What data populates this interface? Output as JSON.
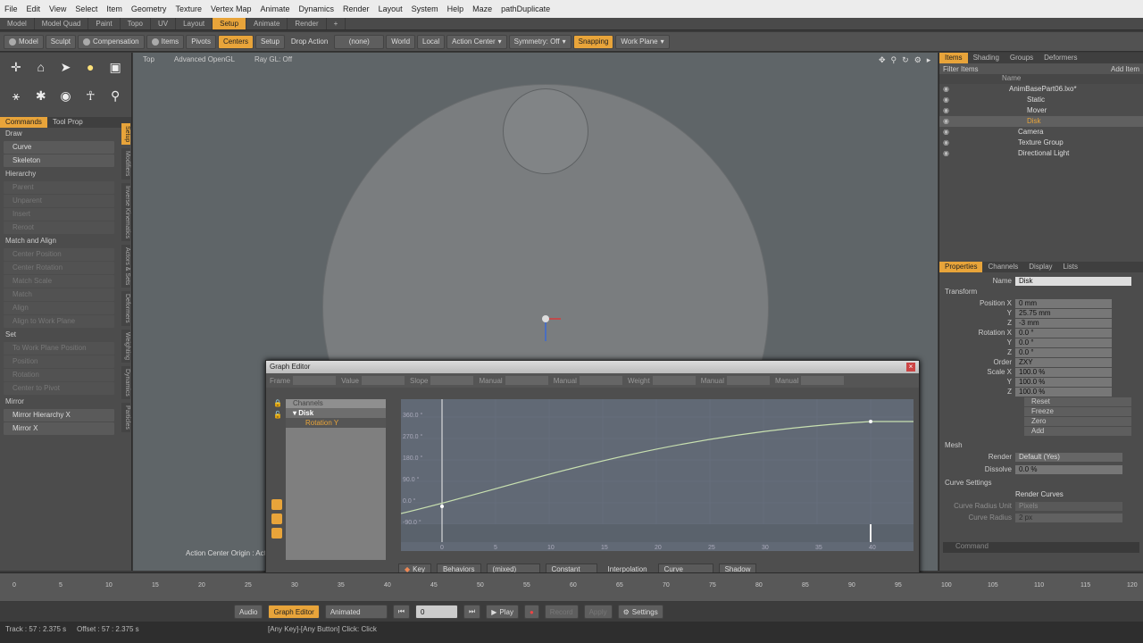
{
  "menu": [
    "File",
    "Edit",
    "View",
    "Select",
    "Item",
    "Geometry",
    "Texture",
    "Vertex Map",
    "Animate",
    "Dynamics",
    "Render",
    "Layout",
    "System",
    "Help",
    "Maze",
    "pathDuplicate"
  ],
  "layout_tabs": [
    "Model",
    "Model Quad",
    "Paint",
    "Topo",
    "UV",
    "Layout",
    "Setup",
    "Animate",
    "Render",
    "+"
  ],
  "active_layout_tab": "Setup",
  "toolbar": {
    "model": "Model",
    "sculpt": "Sculpt",
    "compensation": "Compensation",
    "items": "Items",
    "pivots": "Pivots",
    "centers": "Centers",
    "setup": "Setup",
    "drop_action": "Drop Action",
    "drop_value": "(none)",
    "world": "World",
    "local": "Local",
    "action_center": "Action Center",
    "symmetry": "Symmetry: Off",
    "snapping": "Snapping",
    "work_plane": "Work Plane"
  },
  "viewport_header": {
    "view": "Top",
    "render": "Advanced OpenGL",
    "raygl": "Ray GL: Off"
  },
  "action_center_label": "Action Center Origin : Acti",
  "left_tabs": [
    "Commands",
    "Tool Prop"
  ],
  "vertical_tabs": [
    "Setup",
    "Modifiers",
    "Inverse Kinematics",
    "Actors & Sets",
    "Deformers",
    "Weighting",
    "Dynamics",
    "Particles"
  ],
  "commands": [
    {
      "type": "sec",
      "label": "Draw"
    },
    {
      "type": "cmd",
      "label": "Curve"
    },
    {
      "type": "cmd",
      "label": "Skeleton"
    },
    {
      "type": "sec",
      "label": "Hierarchy"
    },
    {
      "type": "dim",
      "label": "Parent"
    },
    {
      "type": "dim",
      "label": "Unparent"
    },
    {
      "type": "dim",
      "label": "Insert"
    },
    {
      "type": "dim",
      "label": "Reroot"
    },
    {
      "type": "sec",
      "label": "Match and Align"
    },
    {
      "type": "dim",
      "label": "Center Position"
    },
    {
      "type": "dim",
      "label": "Center Rotation"
    },
    {
      "type": "dim",
      "label": "Match Scale"
    },
    {
      "type": "dim",
      "label": "Match"
    },
    {
      "type": "dim",
      "label": "Align"
    },
    {
      "type": "dim",
      "label": "Align to Work Plane"
    },
    {
      "type": "sec",
      "label": "Set"
    },
    {
      "type": "dim",
      "label": "To Work Plane Position"
    },
    {
      "type": "dim",
      "label": "Position"
    },
    {
      "type": "dim",
      "label": "Rotation"
    },
    {
      "type": "dim",
      "label": "Center to Pivot"
    },
    {
      "type": "sec",
      "label": "Mirror"
    },
    {
      "type": "cmd",
      "label": "Mirror Hierarchy X"
    },
    {
      "type": "cmd",
      "label": "Mirror X"
    }
  ],
  "items_tabs": [
    "Items",
    "Shading",
    "Groups",
    "Deformers"
  ],
  "filter_items": "Filter Items",
  "add_item": "Add Item",
  "name_header": "Name",
  "scene_items": [
    {
      "label": "AnimBasePart06.lxo*",
      "indent": 0,
      "sel": false
    },
    {
      "label": "Static",
      "indent": 2,
      "sel": false
    },
    {
      "label": "Mover",
      "indent": 2,
      "sel": false
    },
    {
      "label": "Disk",
      "indent": 2,
      "sel": true
    },
    {
      "label": "Camera",
      "indent": 1,
      "sel": false
    },
    {
      "label": "Texture Group",
      "indent": 1,
      "sel": false
    },
    {
      "label": "Directional Light",
      "indent": 1,
      "sel": false
    }
  ],
  "prop_tabs": [
    "Properties",
    "Channels",
    "Display",
    "Lists"
  ],
  "properties": {
    "name_label": "Name",
    "name": "Disk",
    "transform": "Transform",
    "rows": [
      {
        "label": "Position X",
        "value": "0 mm"
      },
      {
        "label": "Y",
        "value": "25.75 mm"
      },
      {
        "label": "Z",
        "value": "-3 mm"
      },
      {
        "label": "Rotation X",
        "value": "0.0 °"
      },
      {
        "label": "Y",
        "value": "0.0 °"
      },
      {
        "label": "Z",
        "value": "0.0 °"
      },
      {
        "label": "Order",
        "value": "ZXY"
      },
      {
        "label": "Scale X",
        "value": "100.0 %"
      },
      {
        "label": "Y",
        "value": "100.0 %"
      },
      {
        "label": "Z",
        "value": "100.0 %"
      }
    ],
    "reset_buttons": [
      "Reset",
      "Freeze",
      "Zero",
      "Add"
    ],
    "mesh": "Mesh",
    "render_label": "Render",
    "render": "Default (Yes)",
    "dissolve_label": "Dissolve",
    "dissolve": "0.0 %",
    "curve_settings": "Curve Settings",
    "render_curves": "Render Curves",
    "curve_radius_unit_label": "Curve Radius Unit",
    "curve_radius_unit": "Pixels",
    "curve_radius_label": "Curve Radius",
    "curve_radius": "2 px",
    "command": "Command"
  },
  "graph_editor": {
    "title": "Graph Editor",
    "toolbar": [
      "Frame",
      "Value",
      "Slope",
      "Manual",
      "Manual",
      "Weight",
      "Manual",
      "Manual"
    ],
    "channels_header": "Channels",
    "channel_item": "Disk",
    "channel_sub": "Rotation Y",
    "y_ticks": [
      "360.0 °",
      "270.0 °",
      "180.0 °",
      "90.0 °",
      "0.0 °",
      "-90.0 °"
    ],
    "x_ticks": [
      "0",
      "5",
      "10",
      "15",
      "20",
      "25",
      "30",
      "35",
      "40"
    ],
    "bottom": {
      "key": "Key",
      "behaviors": "Behaviors",
      "mixed": "(mixed)",
      "constant": "Constant",
      "interpolation": "Interpolation",
      "curve": "Curve",
      "shadow": "Shadow"
    }
  },
  "timeline_ticks": [
    "0",
    "5",
    "10",
    "15",
    "20",
    "25",
    "30",
    "35",
    "40",
    "45",
    "50",
    "55",
    "60",
    "65",
    "70",
    "75",
    "80",
    "85",
    "90",
    "95",
    "100",
    "105",
    "110",
    "115",
    "120"
  ],
  "transport": {
    "audio": "Audio",
    "graph_editor": "Graph Editor",
    "animated": "Animated",
    "frame": "0",
    "play": "Play",
    "record": "Record",
    "apply": "Apply",
    "settings": "Settings"
  },
  "status": {
    "track": "Track : 57 : 2.375 s",
    "offset": "Offset : 57 : 2.375 s",
    "hint": "[Any Key]-[Any Button] Click: Click"
  }
}
